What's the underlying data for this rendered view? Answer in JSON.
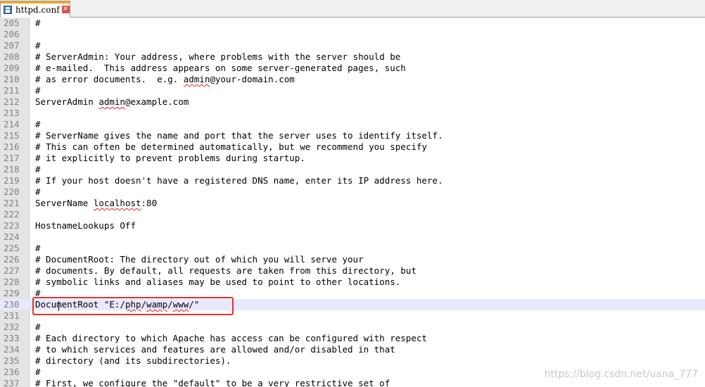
{
  "tab": {
    "title": "httpd.conf"
  },
  "lines": [
    {
      "n": "205",
      "text": "#"
    },
    {
      "n": "206",
      "text": ""
    },
    {
      "n": "207",
      "text": "#"
    },
    {
      "n": "208",
      "text": "# ServerAdmin: Your address, where problems with the server should be"
    },
    {
      "n": "209",
      "text": "# e-mailed.  This address appears on some server-generated pages, such"
    },
    {
      "n": "210",
      "text": "# as error documents.  e.g. admin@your-domain.com"
    },
    {
      "n": "211",
      "text": "#"
    },
    {
      "n": "212",
      "text": "ServerAdmin admin@example.com"
    },
    {
      "n": "213",
      "text": ""
    },
    {
      "n": "214",
      "text": "#"
    },
    {
      "n": "215",
      "text": "# ServerName gives the name and port that the server uses to identify itself."
    },
    {
      "n": "216",
      "text": "# This can often be determined automatically, but we recommend you specify"
    },
    {
      "n": "217",
      "text": "# it explicitly to prevent problems during startup."
    },
    {
      "n": "218",
      "text": "#"
    },
    {
      "n": "219",
      "text": "# If your host doesn't have a registered DNS name, enter its IP address here."
    },
    {
      "n": "220",
      "text": "#"
    },
    {
      "n": "221",
      "text": "ServerName localhost:80"
    },
    {
      "n": "222",
      "text": ""
    },
    {
      "n": "223",
      "text": "HostnameLookups Off"
    },
    {
      "n": "224",
      "text": ""
    },
    {
      "n": "225",
      "text": "#"
    },
    {
      "n": "226",
      "text": "# DocumentRoot: The directory out of which you will serve your"
    },
    {
      "n": "227",
      "text": "# documents. By default, all requests are taken from this directory, but"
    },
    {
      "n": "228",
      "text": "# symbolic links and aliases may be used to point to other locations."
    },
    {
      "n": "229",
      "text": "#"
    },
    {
      "n": "230",
      "text": "DocumentRoot \"E:/php/wamp/www/\"",
      "current": true
    },
    {
      "n": "231",
      "text": ""
    },
    {
      "n": "232",
      "text": "#"
    },
    {
      "n": "233",
      "text": "# Each directory to which Apache has access can be configured with respect"
    },
    {
      "n": "234",
      "text": "# to which services and features are allowed and/or disabled in that"
    },
    {
      "n": "235",
      "text": "# directory (and its subdirectories)."
    },
    {
      "n": "236",
      "text": "#"
    },
    {
      "n": "237",
      "text": "# First, we configure the \"default\" to be a very restrictive set of"
    }
  ],
  "spellcheck_words": [
    "admin",
    "localhost",
    "php",
    "wamp",
    "www"
  ],
  "watermark": "https://blog.csdn.net/uana_777",
  "colors": {
    "highlight_border": "#e4322b",
    "current_line": "#e8e8ff",
    "tab_accent": "#f5a623"
  }
}
